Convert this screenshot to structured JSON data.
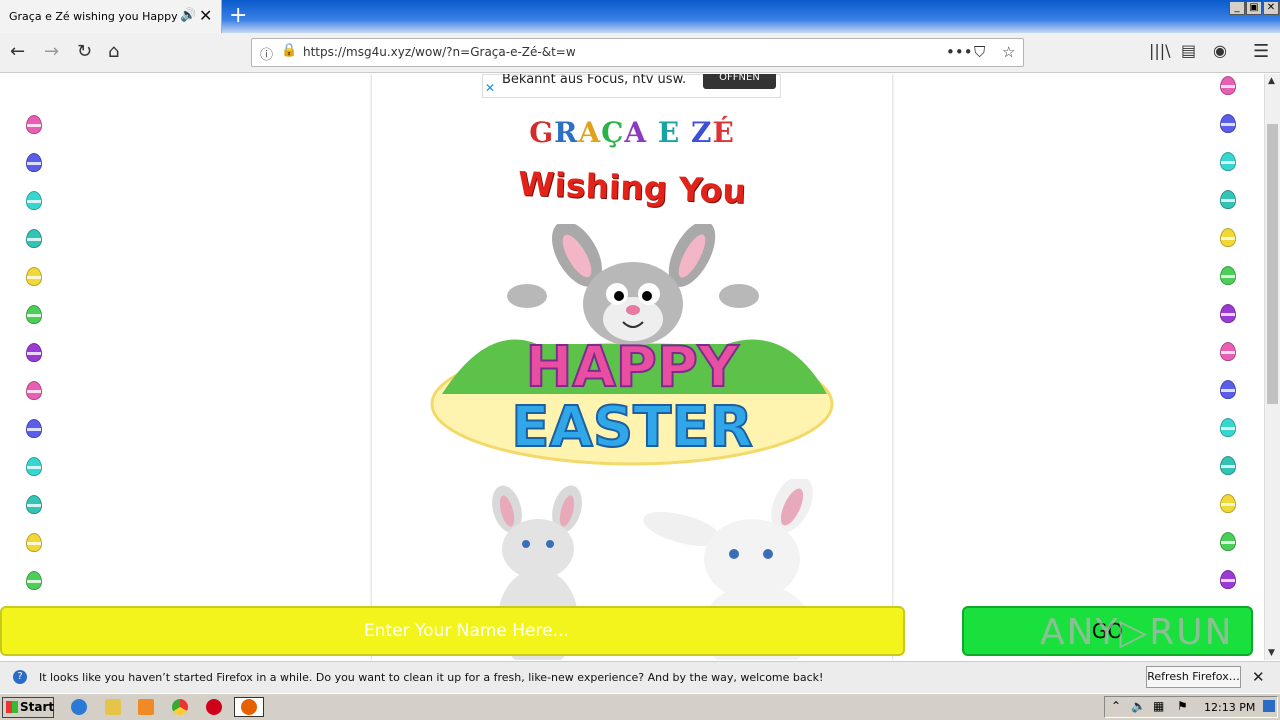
{
  "browser": {
    "tab_title": "Graça e Zé wishing you Happy East",
    "url": "https://msg4u.xyz/wow/?n=Graça-e-Zé-&t=w",
    "url_actions": "•••"
  },
  "page": {
    "ad_text": "Bekannt aus Focus, ntv usw.",
    "ad_button": "ÖFFNEN",
    "name_title": "GRAÇA E ZÉ",
    "name_colors": [
      "#d62b2b",
      "#2d6fc4",
      "#e0a21a",
      "#2bb34a",
      "#8a3bc2",
      "#e6591f",
      "#1aa3a3",
      "#c7328f",
      "#3c4fd6",
      "#d33"
    ],
    "wishing": "Wishing You",
    "happy": "HAPPY",
    "easter": "EASTER",
    "input_placeholder": "Enter Your Name Here...",
    "go_button": "GO",
    "watermark": "ANY▷RUN"
  },
  "notification": {
    "message": "It looks like you haven’t started Firefox in a while. Do you want to clean it up for a fresh, like-new experience? And by the way, welcome back!",
    "refresh_button": "Refresh Firefox…"
  },
  "taskbar": {
    "start_label": "Start",
    "clock": "12:13 PM"
  },
  "egg_colors": [
    "#e85fb3",
    "#5a5ee8",
    "#37d6d0",
    "#34c3b7",
    "#f2d836",
    "#4ccf58",
    "#9b3bd6"
  ]
}
